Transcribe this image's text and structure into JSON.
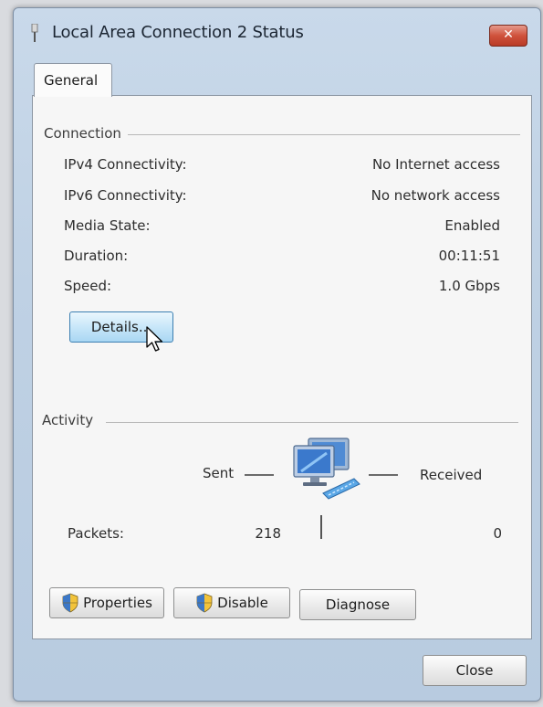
{
  "window": {
    "title": "Local Area Connection 2 Status",
    "close_glyph": "✕"
  },
  "tabs": [
    {
      "label": "General"
    }
  ],
  "connection": {
    "group_label": "Connection",
    "rows": [
      {
        "label": "IPv4 Connectivity:",
        "value": "No Internet access"
      },
      {
        "label": "IPv6 Connectivity:",
        "value": "No network access"
      },
      {
        "label": "Media State:",
        "value": "Enabled"
      },
      {
        "label": "Duration:",
        "value": "00:11:51"
      },
      {
        "label": "Speed:",
        "value": "1.0 Gbps"
      }
    ],
    "details_button": "Details..."
  },
  "activity": {
    "group_label": "Activity",
    "sent_label": "Sent",
    "received_label": "Received",
    "packets_label": "Packets:",
    "packets_sent": "218",
    "packets_received": "0"
  },
  "buttons": {
    "properties": "Properties",
    "disable": "Disable",
    "diagnose": "Diagnose",
    "close": "Close"
  },
  "icons": {
    "title": "network-adapter-icon",
    "shield": "uac-shield-icon",
    "network": "network-computers-icon",
    "cursor": "mouse-pointer-icon"
  }
}
